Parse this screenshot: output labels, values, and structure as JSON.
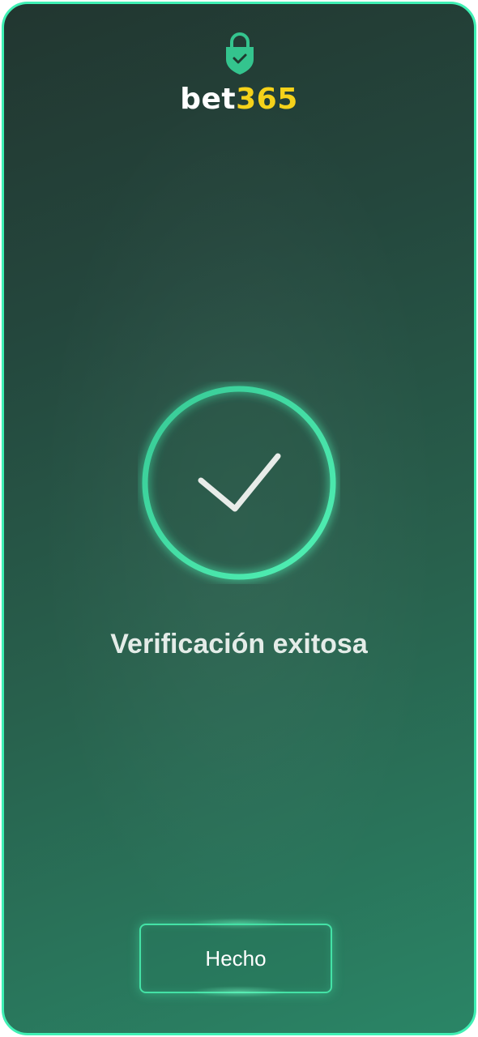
{
  "header": {
    "icon": "lock-check-icon",
    "logo_text_main": "bet",
    "logo_text_accent": "365"
  },
  "main": {
    "status_icon": "checkmark-circle-icon",
    "status_title": "Verificación exitosa"
  },
  "footer": {
    "done_label": "Hecho"
  },
  "colors": {
    "accent": "#3ff0b4",
    "logo_accent": "#f5d21a",
    "background_top": "#223630",
    "background_bottom": "#2a8566"
  }
}
